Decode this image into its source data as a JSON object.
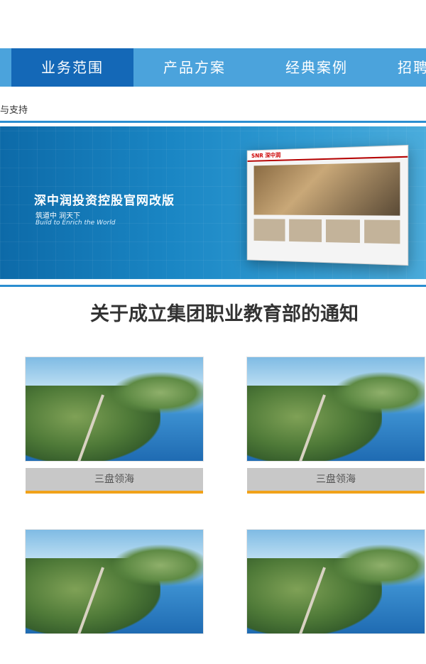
{
  "nav": {
    "items": [
      {
        "label": "业务范围",
        "active": true
      },
      {
        "label": "产品方案",
        "active": false
      },
      {
        "label": "经典案例",
        "active": false
      },
      {
        "label": "招聘",
        "active": false
      }
    ]
  },
  "breadcrumb": "与支持",
  "banner": {
    "title": "深中润投资控股官网改版",
    "subtitle_cn": "筑道中 润天下",
    "subtitle_en": "Build to Enrich the World",
    "screen_logo": "SNR 深中润"
  },
  "article": {
    "title": "关于成立集团职业教育部的通知"
  },
  "cards": [
    {
      "label": "三盘领海"
    },
    {
      "label": "三盘领海"
    },
    {
      "label": ""
    },
    {
      "label": ""
    }
  ],
  "colors": {
    "nav_bg": "#4ba3dc",
    "nav_active": "#1468b7",
    "accent_underline": "#f0a21a"
  }
}
